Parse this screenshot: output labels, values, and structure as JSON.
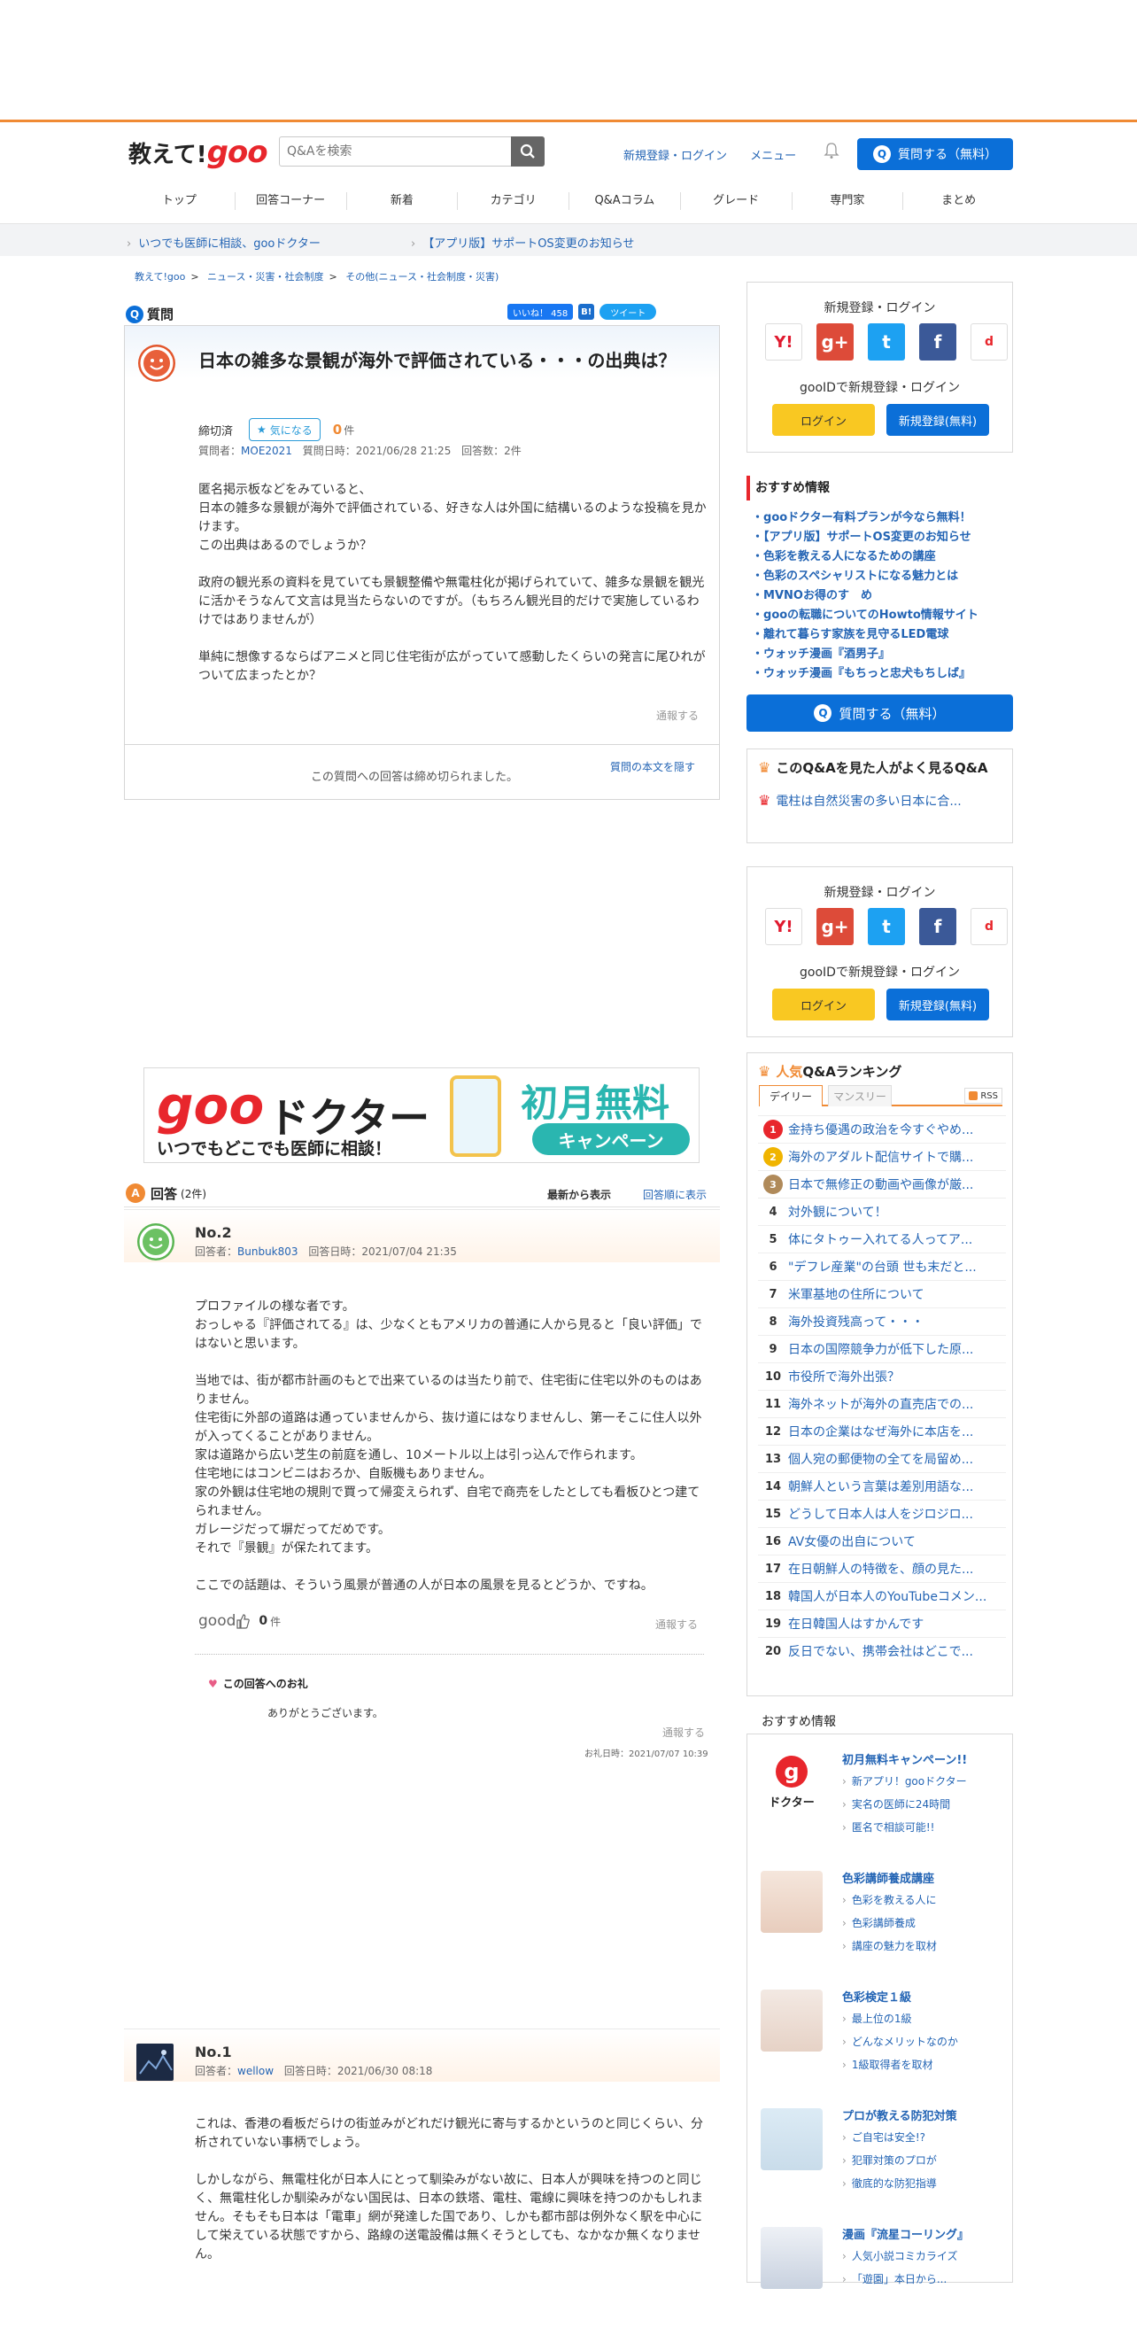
{
  "header": {
    "logo_text": "教えて!",
    "logo_goo": "goo",
    "search_placeholder": "Q&Aを検索",
    "register_login": "新規登録・ログイン",
    "menu": "メニュー",
    "ask_button": "質問する（無料）"
  },
  "nav": [
    "トップ",
    "回答コーナー",
    "新着",
    "カテゴリ",
    "Q&Aコラム",
    "グレード",
    "専門家",
    "まとめ"
  ],
  "notices": [
    "いつでも医師に相談、gooドクター",
    "【アプリ版】サポートOS変更のお知らせ"
  ],
  "breadcrumb": [
    "教えて!goo",
    "ニュース・災害・社会制度",
    "その他(ニュース・社会制度・災害)"
  ],
  "question": {
    "section_label": "質問",
    "like_label": "いいね！ 458",
    "hatena": "B!",
    "tweet": "ツイート",
    "title": "日本の雑多な景観が海外で評価されている・・・の出典は？",
    "status": "締切済",
    "favorite_label": "気になる",
    "favorite_count": "0",
    "favorite_unit": "件",
    "asker_label": "質問者：",
    "asker": "MOE2021",
    "date": "質問日時：2021/06/28 21:25",
    "answers_count": "回答数：2件",
    "body": "匿名掲示板などをみていると、\n日本の雑多な景観が海外で評価されている、好きな人は外国に結構いるのような投稿を見かけます。\nこの出典はあるのでしょうか？\n\n政府の観光系の資料を見ていても景観整備や無電柱化が掲げられていて、雑多な景観を観光に活かそうなんて文言は見当たらないのですが。（もちろん観光目的だけで実施しているわけではありませんが）\n\n単純に想像するならばアニメと同じ住宅街が広がっていて感動したくらいの発言に尾ひれがついて広まったとか？",
    "report": "通報する",
    "closed_message": "この質問への回答は締め切られました。",
    "hide_text": "質問の本文を隠す"
  },
  "ad": {
    "goo": "goo",
    "doctor": "ドクター",
    "sub": "いつでもどこでも医師に相談！",
    "free": "初月無料",
    "campaign": "キャンペーン"
  },
  "answers_header": {
    "label": "回答",
    "count": "(2件)",
    "sort_new": "最新から表示",
    "sort_order": "回答順に表示"
  },
  "answers": [
    {
      "no": "No.2",
      "user_label": "回答者：",
      "user": "Bunbuk803",
      "date": "回答日時：2021/07/04 21:35",
      "body": "プロファイルの様な者です。\nおっしゃる『評価されてる』は、少なくともアメリカの普通に人から見ると「良い評価」ではないと思います。\n\n当地では、街が都市計画のもとで出来ているのは当たり前で、住宅街に住宅以外のものはありません。\n住宅街に外部の道路は通っていませんから、抜け道にはなりませんし、第一そこに住人以外が入ってくることがありません。\n家は道路から広い芝生の前庭を通し、10メートル以上は引っ込んで作られます。\n住宅地にはコンビニはおろか、自販機もありません。\n家の外観は住宅地の規則で買って帰変えられず、自宅で商売をしたとしても看板ひとつ建てられません。\nガレージだって塀だってだめです。\nそれで『景観』が保たれてます。\n\nここでの話題は、そういう風景が普通の人が日本の風景を見るとどうか、ですね。",
      "good": "good",
      "good_count": "0",
      "good_unit": "件",
      "report": "通報する",
      "thanks_title": "この回答へのお礼",
      "thanks_body": "ありがとうございます。",
      "thanks_report": "通報する",
      "thanks_date": "お礼日時：2021/07/07 10:39"
    },
    {
      "no": "No.1",
      "user_label": "回答者：",
      "user": "wellow",
      "date": "回答日時：2021/06/30 08:18",
      "body": "これは、香港の看板だらけの街並みがどれだけ観光に寄与するかというのと同じくらい、分析されていない事柄でしょう。\n\nしかしながら、無電柱化が日本人にとって馴染みがない故に、日本人が興味を持つのと同じく、無電柱化しか馴染みがない国民は、日本の鉄塔、電柱、電線に興味を持つのかもしれません。そもそも日本は「電車」網が発達した国であり、しかも都市部は例外なく駅を中心にして栄えている状態ですから、路線の送電設備は無くそうとしても、なかなか無くなりません。"
    }
  ],
  "sidebar": {
    "login_title": "新規登録・ログイン",
    "goo_id_text": "gooIDで新規登録・ログイン",
    "login_btn": "ログイン",
    "register_btn": "新規登録(無料)",
    "docomo_label": "ログイン",
    "recommend_title": "おすすめ情報",
    "recommend": [
      "gooドクター有料プランが今なら無料！",
      "【アプリ版】サポートOS変更のお知らせ",
      "色彩を教える人になるための講座",
      "色彩のスペシャリストになる魅力とは",
      "MVNOお得のす　め",
      "gooの転職についてのHowto情報サイト",
      "離れて暮らす家族を見守るLED電球",
      "ウォッチ漫画『酒男子』",
      "ウォッチ漫画『もちっと忠犬もちしば』"
    ],
    "ask_button": "質問する（無料）",
    "also_title": "このQ&Aを見た人がよく見るQ&A",
    "also_item": "電柱は自然災害の多い日本に合...",
    "ranking_title_prefix": "人気",
    "ranking_title": "Q&Aランキング",
    "tab_daily": "デイリー",
    "tab_monthly": "マンスリー",
    "rss": "RSS",
    "ranking": [
      {
        "num": "1",
        "title": "金持ち優遇の政治を今すぐやめ..."
      },
      {
        "num": "2",
        "title": "海外のアダルト配信サイトで購..."
      },
      {
        "num": "3",
        "title": "日本で無修正の動画や画像が厳..."
      },
      {
        "num": "4",
        "title": "対外観について！"
      },
      {
        "num": "5",
        "title": "体にタトゥー入れてる人ってア..."
      },
      {
        "num": "6",
        "title": "\"デフレ産業\"の台頭 世も末だと..."
      },
      {
        "num": "7",
        "title": "米軍基地の住所について"
      },
      {
        "num": "8",
        "title": "海外投資残高って・・・"
      },
      {
        "num": "9",
        "title": "日本の国際競争力が低下した原..."
      },
      {
        "num": "10",
        "title": "市役所で海外出張？"
      },
      {
        "num": "11",
        "title": "海外ネットが海外の直売店での..."
      },
      {
        "num": "12",
        "title": "日本の企業はなぜ海外に本店を..."
      },
      {
        "num": "13",
        "title": "個人宛の郵便物の全てを局留め..."
      },
      {
        "num": "14",
        "title": "朝鮮人という言葉は差別用語な..."
      },
      {
        "num": "15",
        "title": "どうして日本人は人をジロジロ..."
      },
      {
        "num": "16",
        "title": "AV女優の出自について"
      },
      {
        "num": "17",
        "title": "在日朝鮮人の特徴を、顔の見た..."
      },
      {
        "num": "18",
        "title": "韓国人が日本人のYouTubeコメン..."
      },
      {
        "num": "19",
        "title": "在日韓国人はすかんです"
      },
      {
        "num": "20",
        "title": "反日でない、携帯会社はどこで..."
      }
    ],
    "osusume_title": "おすすめ情報",
    "osusume": [
      {
        "title": "初月無料キャンペーン!!",
        "lines": [
          "新アプリ！gooドクター",
          "実名の医師に24時間",
          "匿名で相談可能!!"
        ],
        "img_label": "ドクター"
      },
      {
        "title": "色彩講師養成講座",
        "lines": [
          "色彩を教える人に",
          "色彩講師養成",
          "講座の魅力を取材"
        ]
      },
      {
        "title": "色彩検定１級",
        "lines": [
          "最上位の1級",
          "どんなメリットなのか",
          "1級取得者を取材"
        ]
      },
      {
        "title": "プロが教える防犯対策",
        "lines": [
          "ご自宅は安全!?",
          "犯罪対策のプロが",
          "徹底的な防犯指導"
        ]
      },
      {
        "title": "漫画『流星コーリング』",
        "lines": [
          "人気小説コミカライズ",
          "「遊園」本日から..."
        ]
      }
    ]
  },
  "colors": {
    "accent_orange": "#f08a34",
    "brand_blue": "#0b6fd8",
    "link_blue": "#2364b4",
    "goo_red": "#e8262c"
  }
}
